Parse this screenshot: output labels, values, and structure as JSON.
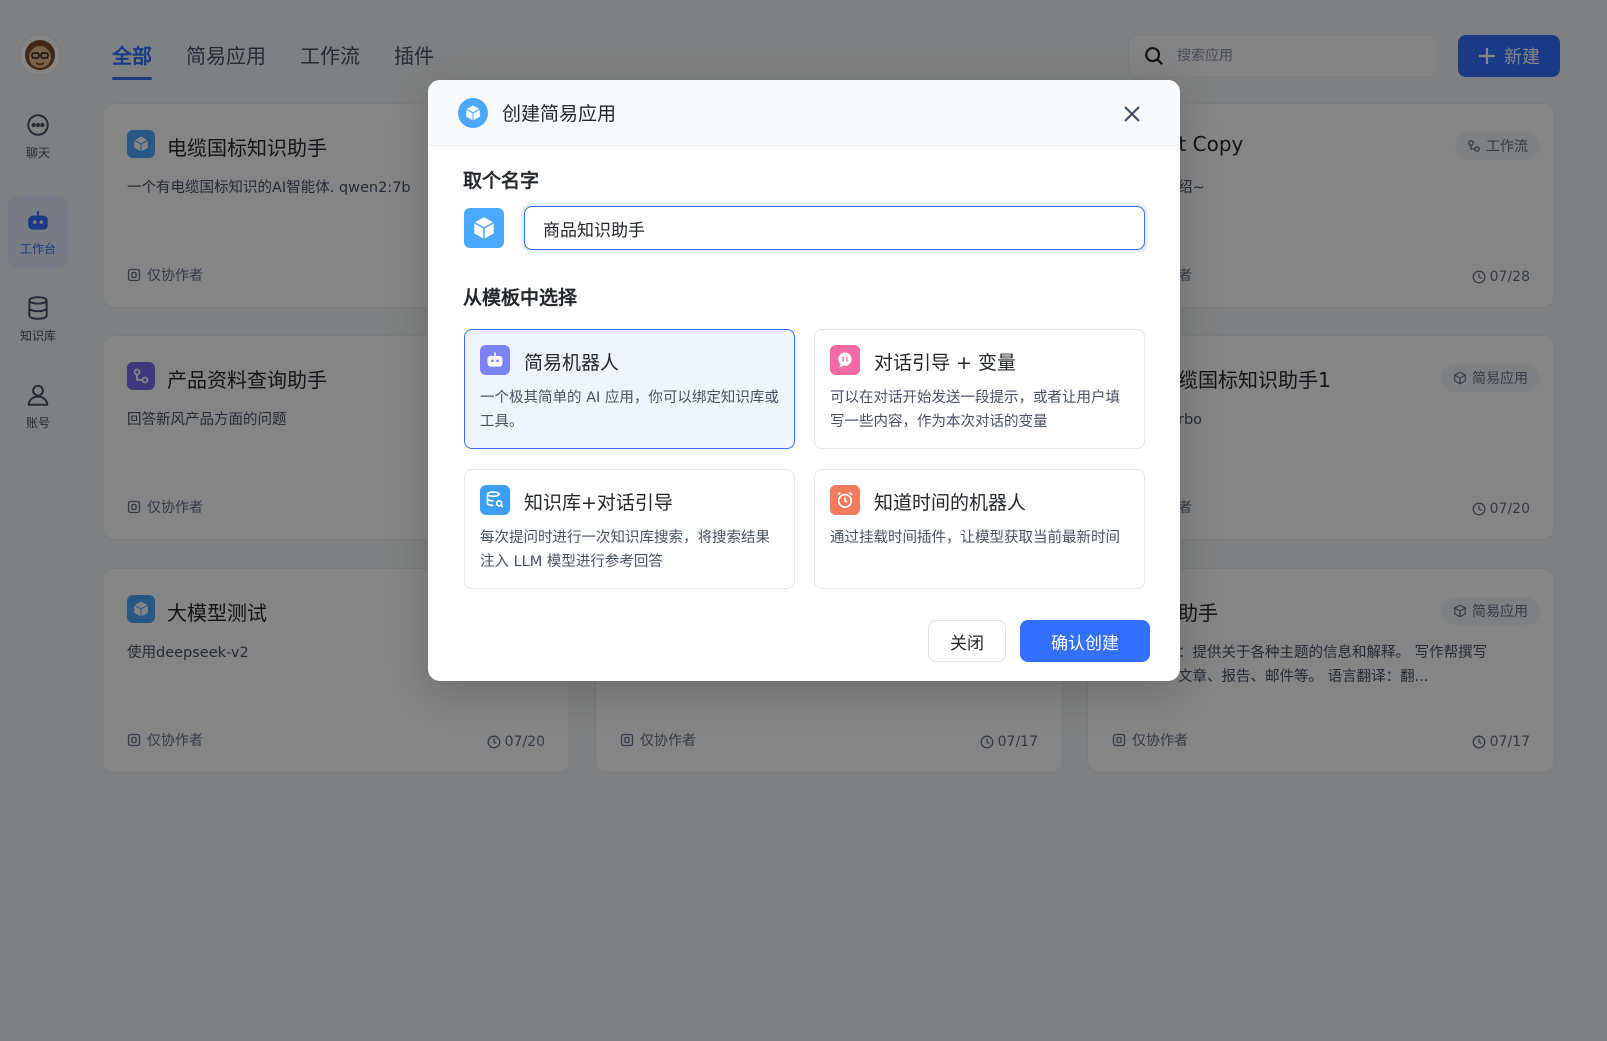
{
  "sidebar": {
    "items": [
      {
        "label": "聊天",
        "icon": "chat-icon"
      },
      {
        "label": "工作台",
        "icon": "robot-icon"
      },
      {
        "label": "知识库",
        "icon": "database-icon"
      },
      {
        "label": "账号",
        "icon": "user-icon"
      }
    ]
  },
  "header": {
    "tabs": [
      "全部",
      "简易应用",
      "工作流",
      "插件"
    ],
    "search_placeholder": "搜索应用",
    "new_button": "新建"
  },
  "cards": [
    {
      "title": "电缆国标知识助手",
      "desc": "一个有电缆国标知识的AI智能体. qwen2:7b",
      "footer": "仅协作者",
      "date": "",
      "badge": "",
      "icon_color": "#4aa8ff",
      "icon": "cube-icon"
    },
    {
      "title": "st Copy",
      "desc": "绍~",
      "footer": "者",
      "date": "07/28",
      "badge": "工作流",
      "icon_color": "",
      "icon": ""
    },
    {
      "title": "产品资料查询助手",
      "desc": "回答新风产品方面的问题",
      "footer": "仅协作者",
      "date": "",
      "badge": "",
      "icon_color": "#7b6cf0",
      "icon": "workflow-icon"
    },
    {
      "title": "缆国标知识助手1",
      "desc": "rbo",
      "footer": "者",
      "date": "07/20",
      "badge": "简易应用",
      "icon_color": "",
      "icon": ""
    },
    {
      "title": "大模型测试",
      "desc": "使用deepseek-v2",
      "footer": "仅协作者",
      "date": "07/20",
      "badge": "",
      "icon_color": "#4aa8ff",
      "icon": "cube-icon"
    },
    {
      "title": "",
      "desc": "",
      "footer": "仅协作者",
      "date": "07/17",
      "badge": "",
      "icon_color": "",
      "icon": ""
    },
    {
      "title": "助手",
      "desc": "：提供关于各种主题的信息和解释。 写作帮撰写文章、报告、邮件等。 语言翻译：翻...",
      "footer": "仅协作者",
      "date": "07/17",
      "badge": "简易应用",
      "icon_color": "",
      "icon": ""
    }
  ],
  "modal": {
    "title": "创建简易应用",
    "name_label": "取个名字",
    "name_value": "商品知识助手",
    "template_label": "从模板中选择",
    "templates": [
      {
        "title": "简易机器人",
        "desc": "一个极其简单的 AI 应用，你可以绑定知识库或工具。",
        "icon": "robot-icon",
        "color": "#7b82f8"
      },
      {
        "title": "对话引导 + 变量",
        "desc": "可以在对话开始发送一段提示，或者让用户填写一些内容，作为本次对话的变量",
        "icon": "chat-bubble-icon",
        "color": "#f56aa5"
      },
      {
        "title": "知识库+对话引导",
        "desc": "每次提问时进行一次知识库搜索，将搜索结果注入 LLM 模型进行参考回答",
        "icon": "database-search-icon",
        "color": "#3ba0f5"
      },
      {
        "title": "知道时间的机器人",
        "desc": "通过挂载时间插件，让模型获取当前最新时间",
        "icon": "alarm-clock-icon",
        "color": "#f47b5e"
      }
    ],
    "close_button": "关闭",
    "confirm_button": "确认创建"
  }
}
